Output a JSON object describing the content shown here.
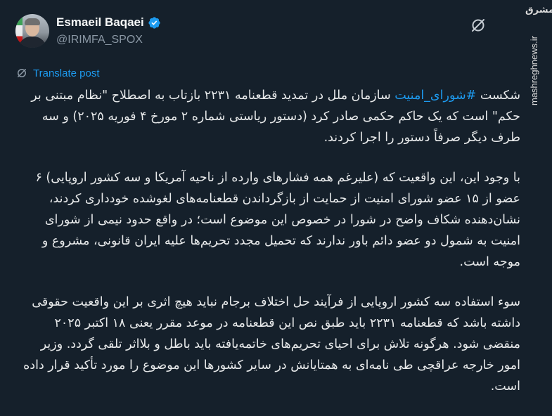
{
  "author": {
    "name": "Esmaeil Baqaei",
    "handle": "@IRIMFA_SPOX",
    "verified_icon": "verified-badge-icon"
  },
  "translate_label": "Translate post",
  "post": {
    "p1_prefix": "شکست ",
    "p1_hashtag": "#شورای_امنیت",
    "p1_rest": " سازمان ملل در تمدید قطعنامه ۲۲۳۱ بازتاب به اصطلاح \"نظام مبتنی بر حکم\" است که یک حاکم حکمی صادر کرد (دستور ریاستی شماره ۲ مورخ ۴ فوریه ۲۰۲۵) و سه طرف دیگر صرفاً دستور را اجرا کردند.",
    "p2": "با وجود این، این واقعیت که (علیرغم همه فشارهای وارده از ناحیه آمریکا و سه کشور اروپایی) ۶ عضو از ۱۵ عضو شورای امنیت از حمایت از بازگرداندن قطعنامه‌های لغوشده خودداری کردند، نشان‌دهنده شکاف واضح در شورا در خصوص این موضوع است؛ در واقع حدود نیمی از شورای امنیت به شمول دو عضو دائم باور ندارند که تحمیل مجدد تحریم‌ها علیه ایران قانونی، مشروع و موجه است.",
    "p3": "سوء استفاده سه کشور اروپایی از فرآیند حل اختلاف برجام نباید هیچ اثری بر این واقعیت حقوقی داشته باشد که قطعنامه ۲۲۳۱ باید طبق نص این قطعنامه در موعد مقرر یعنی ۱۸ اکتبر ۲۰۲۵ منقضی شود. هرگونه تلاش برای احیای تحریم‌های خاتمه‌یافته باید باطل و بلااثر تلقی گردد. وزیر امور خارجه عراقچی طی نامه‌ای به همتایانش در سایر کشورها این موضوع را مورد تأکید قرار داده است."
  },
  "watermark": {
    "logo_text": "مشرق",
    "url": "mashreghnews.ir"
  },
  "colors": {
    "background": "#15202b",
    "text": "#e7e9ea",
    "accent": "#1d9bf0",
    "muted": "#8b98a5"
  }
}
